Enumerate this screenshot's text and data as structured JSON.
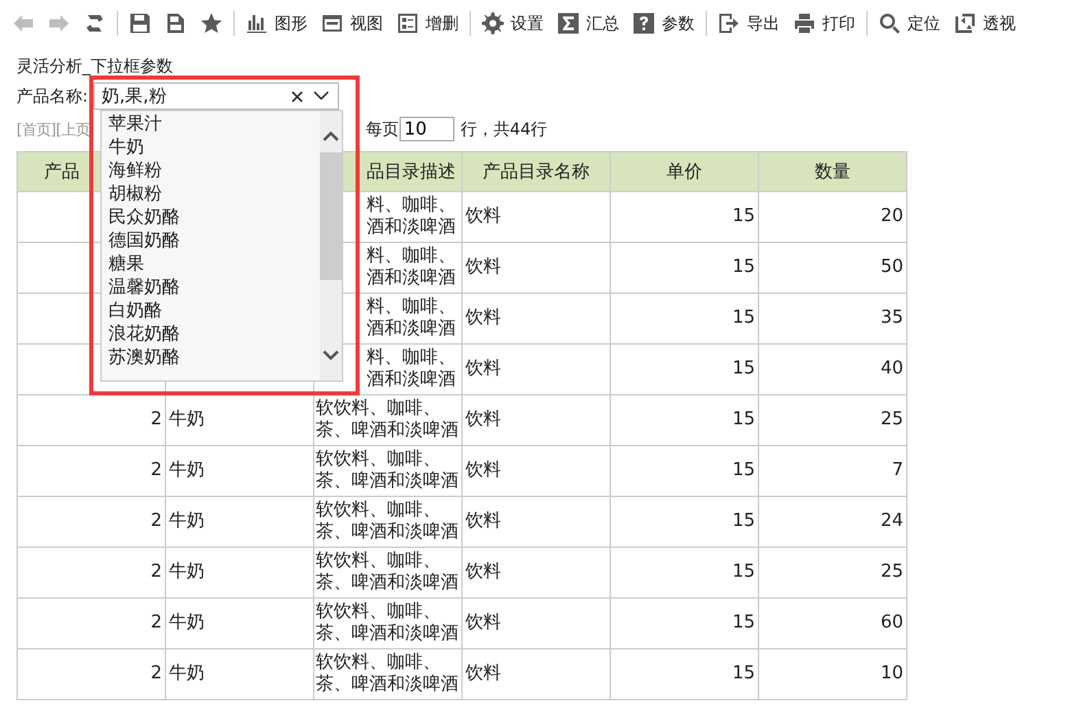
{
  "toolbar": [
    [
      {
        "disabled": true
      },
      {
        "disabled": true
      },
      {
        "disabled": false
      }
    ],
    [
      {
        "disabled": false
      },
      {
        "disabled": false
      },
      {
        "disabled": false
      }
    ],
    [
      {
        "label": "图形",
        "disabled": false
      },
      {
        "label": "视图",
        "disabled": false
      },
      {
        "label": "增删",
        "disabled": false
      }
    ],
    [
      {
        "label": "设置",
        "disabled": false
      },
      {
        "label": "汇总",
        "disabled": false
      },
      {
        "label": "参数",
        "disabled": false
      }
    ],
    [
      {
        "label": "导出",
        "disabled": false
      },
      {
        "label": "打印",
        "disabled": false
      }
    ],
    [
      {
        "label": "定位",
        "disabled": false
      },
      {
        "label": "透视",
        "disabled": false
      }
    ]
  ],
  "title": "灵活分析_下拉框参数",
  "filter": {
    "label": "产品名称:",
    "value": "奶,果,粉",
    "options": [
      "苹果汁",
      "牛奶",
      "海鲜粉",
      "胡椒粉",
      "民众奶酪",
      "德国奶酪",
      "糖果",
      "温馨奶酪",
      "白奶酪",
      "浪花奶酪",
      "苏澳奶酪"
    ]
  },
  "pager": {
    "links": "[首页][上页",
    "per_page_label": "每页",
    "per_page": "10",
    "total": "行，共44行"
  },
  "table": {
    "columns": [
      "产品",
      "",
      "品目录描述",
      "产品目录名称",
      "单价",
      "数量"
    ],
    "rows": [
      {
        "kind": "covered",
        "cells": [
          "",
          "",
          "料、咖啡、酒和淡啤酒",
          "饮料",
          "15",
          "20"
        ]
      },
      {
        "kind": "covered",
        "cells": [
          "",
          "",
          "料、咖啡、酒和淡啤酒",
          "饮料",
          "15",
          "50"
        ]
      },
      {
        "kind": "covered",
        "cells": [
          "",
          "",
          "料、咖啡、酒和淡啤酒",
          "饮料",
          "15",
          "35"
        ]
      },
      {
        "kind": "covered",
        "cells": [
          "",
          "",
          "料、咖啡、酒和淡啤酒",
          "饮料",
          "15",
          "40"
        ]
      },
      {
        "kind": "full",
        "cells": [
          "2",
          "牛奶",
          "软饮料、咖啡、茶、啤酒和淡啤酒",
          "饮料",
          "15",
          "25"
        ]
      },
      {
        "kind": "full",
        "cells": [
          "2",
          "牛奶",
          "软饮料、咖啡、茶、啤酒和淡啤酒",
          "饮料",
          "15",
          "7"
        ]
      },
      {
        "kind": "full",
        "cells": [
          "2",
          "牛奶",
          "软饮料、咖啡、茶、啤酒和淡啤酒",
          "饮料",
          "15",
          "24"
        ]
      },
      {
        "kind": "full",
        "cells": [
          "2",
          "牛奶",
          "软饮料、咖啡、茶、啤酒和淡啤酒",
          "饮料",
          "15",
          "25"
        ]
      },
      {
        "kind": "full",
        "cells": [
          "2",
          "牛奶",
          "软饮料、咖啡、茶、啤酒和淡啤酒",
          "饮料",
          "15",
          "60"
        ]
      },
      {
        "kind": "full",
        "cells": [
          "2",
          "牛奶",
          "软饮料、咖啡、茶、啤酒和淡啤酒",
          "饮料",
          "15",
          "10"
        ]
      }
    ]
  }
}
